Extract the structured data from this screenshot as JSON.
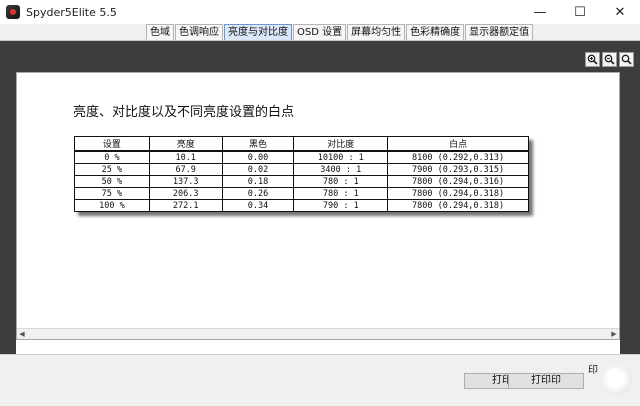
{
  "window": {
    "title": "Spyder5Elite 5.5",
    "minimize": "—",
    "maximize": "☐",
    "close": "✕"
  },
  "tabs": [
    {
      "label": "色域"
    },
    {
      "label": "色调响应"
    },
    {
      "label": "亮度与对比度",
      "active": true
    },
    {
      "label": "OSD 设置"
    },
    {
      "label": "屏幕均匀性"
    },
    {
      "label": "色彩精确度"
    },
    {
      "label": "显示器额定值"
    }
  ],
  "icons": {
    "zoom_in": "zoom-in-icon",
    "zoom_out": "zoom-out-icon",
    "zoom_fit": "zoom-fit-icon"
  },
  "report": {
    "title": "亮度、对比度以及不同亮度设置的白点",
    "table": {
      "headers": [
        "设置",
        "亮度",
        "黑色",
        "对比度",
        "白点"
      ],
      "rows": [
        [
          "0 %",
          "10.1",
          "0.00",
          "10100 : 1",
          "8100 (0.292,0.313)"
        ],
        [
          "25 %",
          "67.9",
          "0.02",
          "3400 : 1",
          "7900 (0.293,0.315)"
        ],
        [
          "50 %",
          "137.3",
          "0.18",
          "780 : 1",
          "7800 (0.294,0.316)"
        ],
        [
          "75 %",
          "206.3",
          "0.26",
          "780 : 1",
          "7800 (0.294,0.318)"
        ],
        [
          "100 %",
          "272.1",
          "0.34",
          "790 : 1",
          "7800 (0.294,0.318)"
        ]
      ]
    }
  },
  "bottom": {
    "partial_label": "印",
    "print_button_1": "打印",
    "print_button_2": "打印印"
  },
  "colors": {
    "active_tab": "#dbe7f7",
    "background_dark": "#3d3d3d",
    "panel": "#f0f0f0"
  }
}
